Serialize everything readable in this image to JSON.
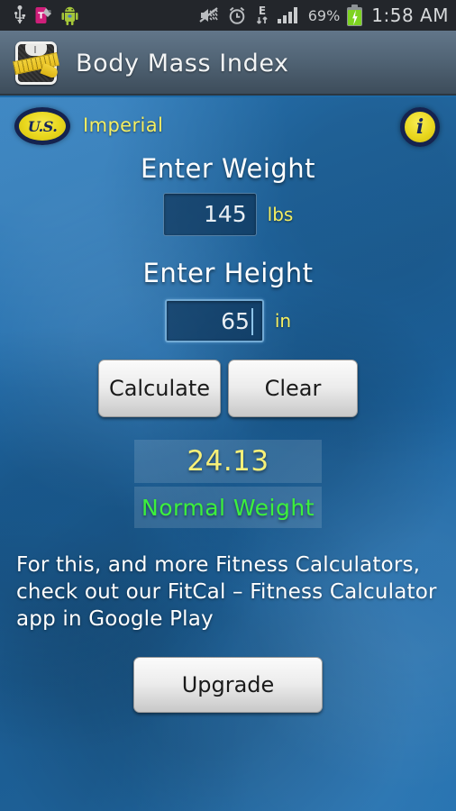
{
  "statusbar": {
    "icons_left": [
      "usb-icon",
      "tmobile-sim-icon",
      "android-icon"
    ],
    "icons_right": [
      "mute-vibrate-icon",
      "alarm-icon",
      "edge-data-icon",
      "signal-bars-icon"
    ],
    "edge_label": "E",
    "battery_percent": "69%",
    "time": "1:58 AM"
  },
  "titlebar": {
    "app_icon": "scale-measuring-tape-icon",
    "title": "Body Mass Index"
  },
  "unit_row": {
    "badge_text": "U.S.",
    "unit_label": "Imperial",
    "info_glyph": "i"
  },
  "weight": {
    "label": "Enter Weight",
    "value": "145",
    "placeholder": "0",
    "unit": "lbs"
  },
  "height": {
    "label": "Enter Height",
    "value": "65",
    "placeholder": "0",
    "unit": "in",
    "focused": true
  },
  "actions": {
    "calculate_label": "Calculate",
    "clear_label": "Clear",
    "upgrade_label": "Upgrade"
  },
  "result": {
    "bmi": "24.13",
    "category": "Normal Weight",
    "bmi_color": "#f7f078",
    "category_color": "#3cf03c"
  },
  "promo": {
    "text": "For this, and more Fitness Calculators, check out our FitCal – Fitness Calculator app in Google Play"
  },
  "theme": {
    "background_blue": "#1e6cac",
    "titlebar_slate": "#516475",
    "accent_yellow": "#f5ef62",
    "badge_navy": "#15234f"
  }
}
